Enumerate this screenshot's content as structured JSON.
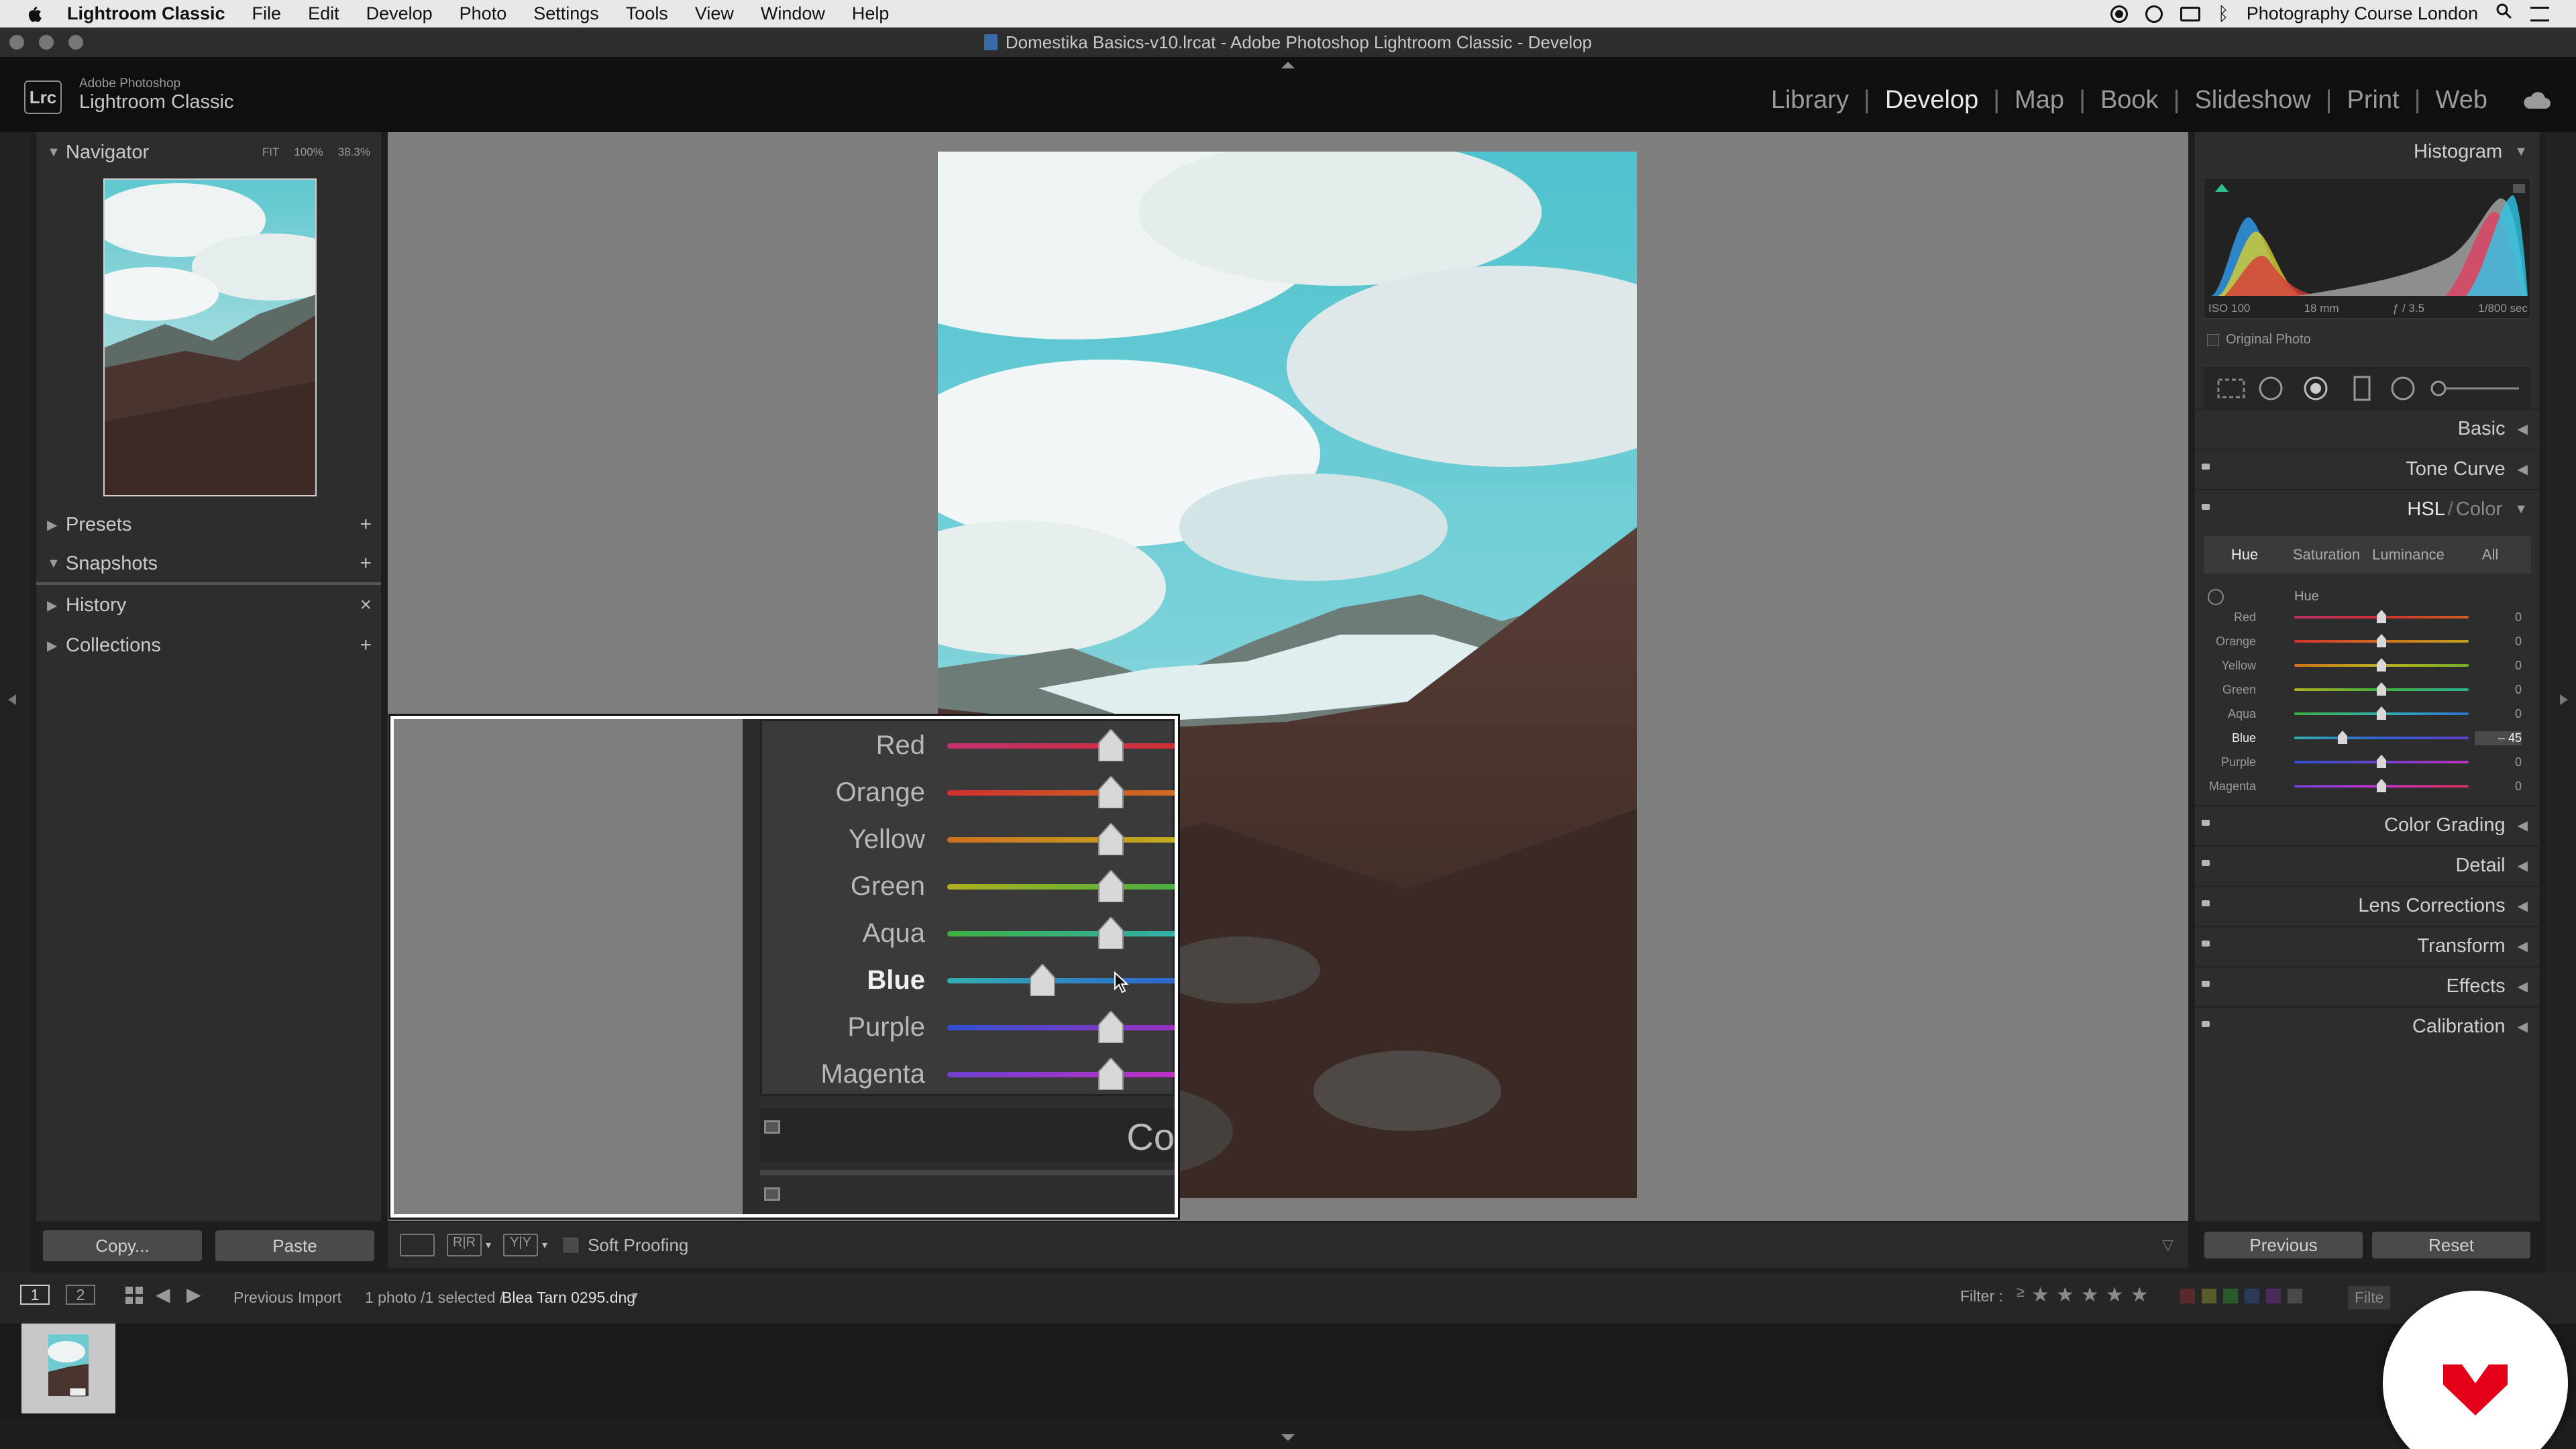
{
  "menubar": {
    "app": "Lightroom Classic",
    "items": [
      "File",
      "Edit",
      "Develop",
      "Photo",
      "Settings",
      "Tools",
      "View",
      "Window",
      "Help"
    ],
    "right_label": "Photography Course London"
  },
  "window_title": "Domestika Basics-v10.lrcat - Adobe Photoshop Lightroom Classic - Develop",
  "identity": {
    "line1": "Adobe Photoshop",
    "line2": "Lightroom Classic",
    "badge": "Lrc"
  },
  "modules": [
    {
      "label": "Library",
      "active": false
    },
    {
      "label": "Develop",
      "active": true
    },
    {
      "label": "Map",
      "active": false
    },
    {
      "label": "Book",
      "active": false
    },
    {
      "label": "Slideshow",
      "active": false
    },
    {
      "label": "Print",
      "active": false
    },
    {
      "label": "Web",
      "active": false
    }
  ],
  "left_panel": {
    "navigator": {
      "title": "Navigator",
      "opts": [
        "FIT",
        "100%",
        "38.3%"
      ]
    },
    "sections": [
      {
        "title": "Presets",
        "action": "+"
      },
      {
        "title": "Snapshots",
        "action": "+"
      },
      {
        "title": "History",
        "action": "×"
      },
      {
        "title": "Collections",
        "action": "+"
      }
    ],
    "copy": "Copy...",
    "paste": "Paste"
  },
  "toolbar": {
    "soft_proofing": "Soft Proofing"
  },
  "right_panel": {
    "histogram": {
      "title": "Histogram",
      "iso": "ISO 100",
      "focal": "18 mm",
      "aperture": "ƒ / 3.5",
      "shutter": "1/800 sec",
      "original_photo": "Original Photo"
    },
    "sections": [
      "Basic",
      "Tone Curve"
    ],
    "hsl_title": "HSL",
    "hsl_color": "Color",
    "hsl_tabs": [
      "Hue",
      "Saturation",
      "Luminance",
      "All"
    ],
    "hue_label": "Hue",
    "hue_sliders": [
      {
        "name": "Red",
        "value": "0"
      },
      {
        "name": "Orange",
        "value": "0"
      },
      {
        "name": "Yellow",
        "value": "0"
      },
      {
        "name": "Green",
        "value": "0"
      },
      {
        "name": "Aqua",
        "value": "0"
      },
      {
        "name": "Blue",
        "value": "– 45"
      },
      {
        "name": "Purple",
        "value": "0"
      },
      {
        "name": "Magenta",
        "value": "0"
      }
    ],
    "lower_sections": [
      "Color Grading",
      "Detail",
      "Lens Corrections",
      "Transform",
      "Effects",
      "Calibration"
    ],
    "previous": "Previous",
    "reset": "Reset"
  },
  "zoom_overlay": {
    "sliders": [
      "Red",
      "Orange",
      "Yellow",
      "Green",
      "Aqua",
      "Blue",
      "Purple",
      "Magenta"
    ],
    "co_text": "Co"
  },
  "filmstrip": {
    "pages": [
      "1",
      "2"
    ],
    "source": "Previous Import",
    "count": "1 photo /1 selected /",
    "filename": "Blea Tarn 0295.dng",
    "filter_label": "Filter :",
    "filter_value": "Filte"
  },
  "colors": {
    "accent": "#e8e8e8",
    "bg": "#2d2d2d",
    "domestika": "#e5001a"
  }
}
